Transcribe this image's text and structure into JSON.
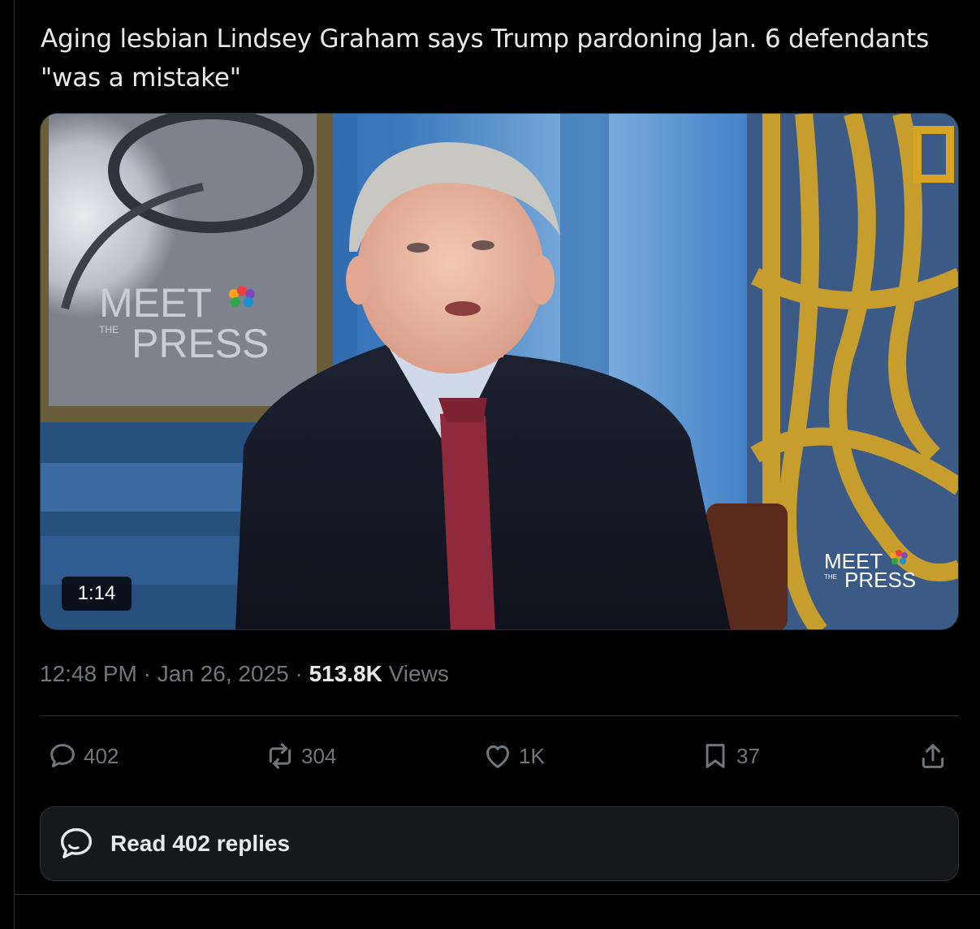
{
  "tweet": {
    "text": "Aging lesbian Lindsey Graham says Trump pardoning Jan. 6 defendants \"was a mistake\""
  },
  "video": {
    "duration": "1:14",
    "watermark_top": "MEET",
    "watermark_small": "THE",
    "watermark_bottom": "PRESS",
    "background_logo_top": "MEET",
    "background_logo_small": "THE",
    "background_logo_bottom": "PRESS"
  },
  "meta": {
    "time": "12:48 PM",
    "separator": "·",
    "date": "Jan 26, 2025",
    "views_count": "513.8K",
    "views_label": "Views"
  },
  "actions": {
    "replies": "402",
    "reposts": "304",
    "likes": "1K",
    "bookmarks": "37"
  },
  "read_replies": {
    "label": "Read 402 replies"
  },
  "colors": {
    "background": "#000000",
    "text_primary": "#e7e9ea",
    "text_secondary": "#71767b",
    "border": "#2f3336",
    "button_background": "#16181c"
  }
}
